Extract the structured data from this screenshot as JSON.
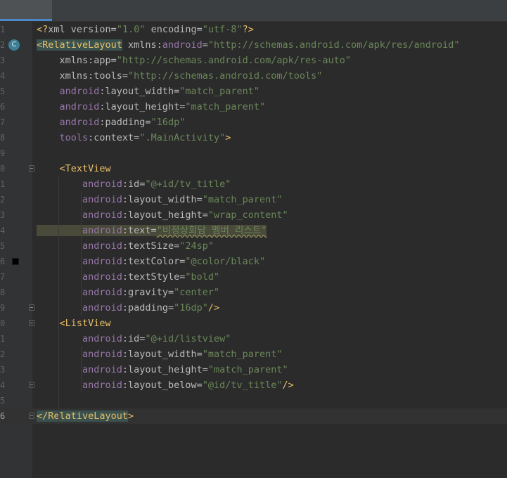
{
  "editor": {
    "gutter_badge": "C",
    "lines": [
      {
        "num": "1",
        "parts": [
          [
            "kw-tag",
            "<?"
          ],
          [
            "attr",
            "xml version"
          ],
          [
            "attr",
            "="
          ],
          [
            "val",
            "\"1.0\""
          ],
          [
            "attr",
            " encoding"
          ],
          [
            "attr",
            "="
          ],
          [
            "val",
            "\"utf-8\""
          ],
          [
            "kw-tag",
            "?>"
          ]
        ]
      },
      {
        "num": "2",
        "parts": [
          [
            "kw-tag hl-tag",
            "<RelativeLayout"
          ],
          [
            "attr",
            " xmlns:"
          ],
          [
            "ns",
            "android"
          ],
          [
            "attr",
            "="
          ],
          [
            "val",
            "\"http://schemas.android.com/apk/res/android\""
          ]
        ]
      },
      {
        "num": "3",
        "parts": [
          [
            "attr",
            "    xmlns:app="
          ],
          [
            "val",
            "\"http://schemas.android.com/apk/res-auto\""
          ]
        ]
      },
      {
        "num": "4",
        "parts": [
          [
            "attr",
            "    xmlns:tools="
          ],
          [
            "val",
            "\"http://schemas.android.com/tools\""
          ]
        ]
      },
      {
        "num": "5",
        "parts": [
          [
            "ns",
            "    android"
          ],
          [
            "attr",
            ":layout_width="
          ],
          [
            "val",
            "\"match_parent\""
          ]
        ]
      },
      {
        "num": "6",
        "parts": [
          [
            "ns",
            "    android"
          ],
          [
            "attr",
            ":layout_height="
          ],
          [
            "val",
            "\"match_parent\""
          ]
        ]
      },
      {
        "num": "7",
        "parts": [
          [
            "ns",
            "    android"
          ],
          [
            "attr",
            ":padding="
          ],
          [
            "val",
            "\"16dp\""
          ]
        ]
      },
      {
        "num": "8",
        "parts": [
          [
            "ns",
            "    tools"
          ],
          [
            "attr",
            ":context="
          ],
          [
            "val",
            "\".MainActivity\""
          ],
          [
            "kw-tag",
            ">"
          ]
        ]
      },
      {
        "num": "9",
        "parts": []
      },
      {
        "num": "0",
        "parts": [
          [
            "kw-tag",
            "    <TextView"
          ]
        ]
      },
      {
        "num": "1",
        "parts": [
          [
            "ns",
            "        android"
          ],
          [
            "attr",
            ":id="
          ],
          [
            "val",
            "\"@+id/tv_title\""
          ]
        ]
      },
      {
        "num": "2",
        "parts": [
          [
            "ns",
            "        android"
          ],
          [
            "attr",
            ":layout_width="
          ],
          [
            "val",
            "\"match_parent\""
          ]
        ]
      },
      {
        "num": "3",
        "parts": [
          [
            "ns",
            "        android"
          ],
          [
            "attr",
            ":layout_height="
          ],
          [
            "val",
            "\"wrap_content\""
          ]
        ]
      },
      {
        "num": "4",
        "parts": [
          [
            "ns warn-hl",
            "        android"
          ],
          [
            "attr warn-hl",
            ":text="
          ],
          [
            "val warn-hl squiggle",
            "\"비정상회담 멤버 리스트\""
          ]
        ]
      },
      {
        "num": "5",
        "parts": [
          [
            "ns",
            "        android"
          ],
          [
            "attr",
            ":textSize="
          ],
          [
            "val",
            "\"24sp\""
          ]
        ]
      },
      {
        "num": "6",
        "parts": [
          [
            "ns",
            "        android"
          ],
          [
            "attr",
            ":textColor="
          ],
          [
            "val",
            "\"@color/black\""
          ]
        ]
      },
      {
        "num": "7",
        "parts": [
          [
            "ns",
            "        android"
          ],
          [
            "attr",
            ":textStyle="
          ],
          [
            "val",
            "\"bold\""
          ]
        ]
      },
      {
        "num": "8",
        "parts": [
          [
            "ns",
            "        android"
          ],
          [
            "attr",
            ":gravity="
          ],
          [
            "val",
            "\"center\""
          ]
        ]
      },
      {
        "num": "9",
        "parts": [
          [
            "ns",
            "        android"
          ],
          [
            "attr",
            ":padding="
          ],
          [
            "val",
            "\"16dp\""
          ],
          [
            "kw-tag",
            "/>"
          ]
        ]
      },
      {
        "num": "0",
        "parts": [
          [
            "kw-tag",
            "    <ListView"
          ]
        ]
      },
      {
        "num": "1",
        "parts": [
          [
            "ns",
            "        android"
          ],
          [
            "attr",
            ":id="
          ],
          [
            "val",
            "\"@+id/listview\""
          ]
        ]
      },
      {
        "num": "2",
        "parts": [
          [
            "ns",
            "        android"
          ],
          [
            "attr",
            ":layout_width="
          ],
          [
            "val",
            "\"match_parent\""
          ]
        ]
      },
      {
        "num": "3",
        "parts": [
          [
            "ns",
            "        android"
          ],
          [
            "attr",
            ":layout_height="
          ],
          [
            "val",
            "\"match_parent\""
          ]
        ]
      },
      {
        "num": "4",
        "parts": [
          [
            "ns",
            "        android"
          ],
          [
            "attr",
            ":layout_below="
          ],
          [
            "val",
            "\"@id/tv_title\""
          ],
          [
            "kw-tag",
            "/>"
          ]
        ]
      },
      {
        "num": "5",
        "parts": []
      },
      {
        "num": "6",
        "parts": [
          [
            "kw-tag hl-tag",
            "</RelativeLayout"
          ],
          [
            "kw-tag",
            ">"
          ]
        ]
      }
    ]
  }
}
